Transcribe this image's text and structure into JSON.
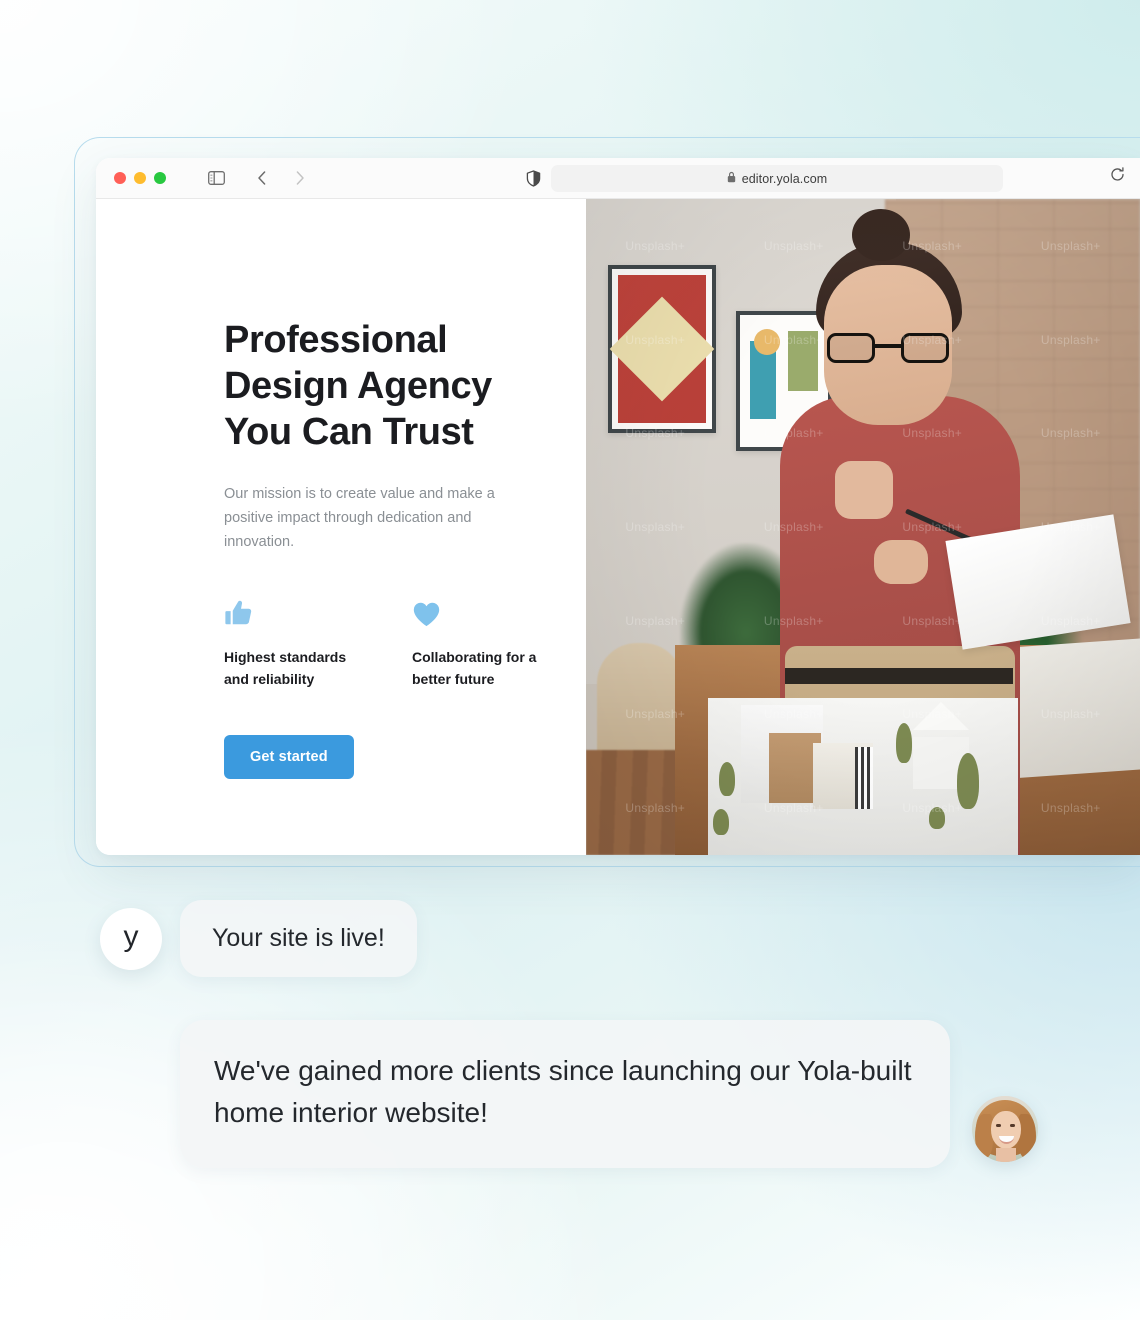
{
  "browser": {
    "url": "editor.yola.com",
    "lock_icon": "lock-icon",
    "reload_icon": "reload-icon",
    "shield_icon": "shield-icon",
    "sidebar_icon": "sidebar-toggle-icon",
    "back_icon": "chevron-left-icon",
    "forward_icon": "chevron-right-icon",
    "traffic_lights": [
      "close-red",
      "minimize-yellow",
      "zoom-green"
    ]
  },
  "site": {
    "hero": {
      "title_lines": [
        "Professional",
        "Design Agency",
        "You Can Trust"
      ],
      "title": "Professional Design Agency You Can Trust",
      "subtitle": "Our mission is to create value and make a positive impact through dedication and innovation.",
      "cta_label": "Get started",
      "cta_color": "#3b9ade",
      "features": [
        {
          "icon": "thumbs-up-icon",
          "icon_color": "#8ec7ec",
          "label": "Highest standards and reliability"
        },
        {
          "icon": "heart-icon",
          "icon_color": "#7fc2ec",
          "label": "Collaborating for a better future"
        }
      ]
    },
    "photo": {
      "alt": "Designer with glasses reviewing plans beside an architectural model",
      "watermark": "Unsplash+"
    }
  },
  "chat": {
    "messages": [
      {
        "avatar": "yola-logo-avatar",
        "avatar_letter": "y",
        "text": "Your site is live!"
      },
      {
        "avatar": "customer-photo-avatar",
        "text": "We've gained more clients since launching our Yola-built home interior website!"
      }
    ]
  },
  "theme": {
    "background_start": "#f4fbfb",
    "background_mid": "#dcf0f2",
    "background_end": "#ffffff",
    "outline_color": "#b7dced",
    "bubble_bg": "#f3f5f6",
    "text_dark": "#24282d",
    "text_muted": "#8a8f94"
  }
}
